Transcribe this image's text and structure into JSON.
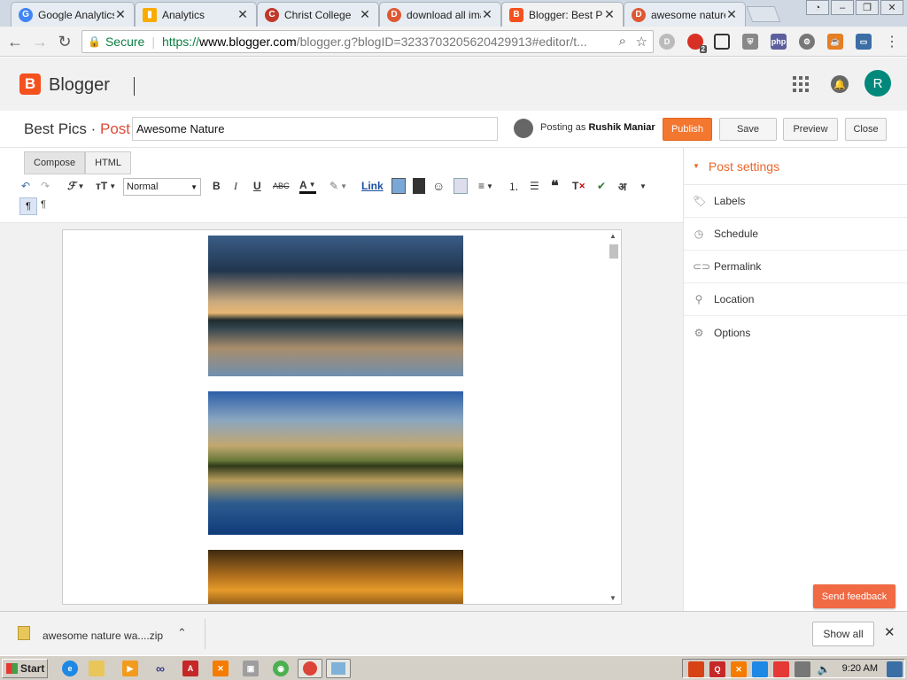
{
  "browser": {
    "tabs": [
      {
        "title": "Google Analytics",
        "icon": "google-icon",
        "active": false
      },
      {
        "title": "Analytics",
        "icon": "analytics-icon",
        "active": false
      },
      {
        "title": "Christ College",
        "icon": "college-icon",
        "active": false
      },
      {
        "title": "download all ima",
        "icon": "duckduckgo-icon",
        "active": false
      },
      {
        "title": "Blogger: Best Pic",
        "icon": "blogger-icon",
        "active": true
      },
      {
        "title": "awesome nature",
        "icon": "duckduckgo-icon",
        "active": false
      }
    ],
    "address": {
      "secure_label": "Secure",
      "scheme": "https://",
      "host": "www.blogger.com",
      "path": "/blogger.g?blogID=3233703205620429913#editor/t..."
    },
    "extension_badge": "2"
  },
  "blogger": {
    "brand": "Blogger",
    "avatar_letter": "R"
  },
  "post_header": {
    "blog_name": "Best Pics",
    "separator": "·",
    "section": "Post",
    "title_value": "Awesome Nature",
    "posting_as_prefix": "Posting as",
    "author": "Rushik Maniar",
    "buttons": {
      "publish": "Publish",
      "save": "Save",
      "preview": "Preview",
      "close": "Close"
    }
  },
  "editor": {
    "modes": {
      "compose": "Compose",
      "html": "HTML"
    },
    "font_size": "Normal",
    "link_label": "Link",
    "hindi_char": "अ"
  },
  "sidebar": {
    "heading": "Post settings",
    "items": [
      {
        "label": "Labels",
        "icon": "tag-icon"
      },
      {
        "label": "Schedule",
        "icon": "clock-icon"
      },
      {
        "label": "Permalink",
        "icon": "link-icon"
      },
      {
        "label": "Location",
        "icon": "pin-icon"
      },
      {
        "label": "Options",
        "icon": "gear-icon"
      }
    ]
  },
  "feedback": "Send feedback",
  "downloads": {
    "file": "awesome nature wa....zip",
    "show_all": "Show all"
  },
  "taskbar": {
    "start": "Start",
    "time": "9:20 AM"
  }
}
